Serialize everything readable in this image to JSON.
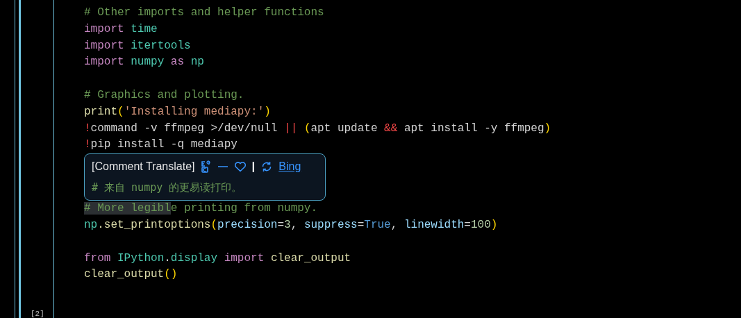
{
  "editor": {
    "lines": [
      {
        "kind": "code",
        "tokens": [
          {
            "text": "# Other imports and helper functions",
            "kind": "comment"
          }
        ]
      },
      {
        "kind": "code",
        "tokens": [
          {
            "text": "import ",
            "kind": "keyword"
          },
          {
            "text": "time",
            "kind": "module"
          }
        ]
      },
      {
        "kind": "code",
        "tokens": [
          {
            "text": "import ",
            "kind": "keyword"
          },
          {
            "text": "itertools",
            "kind": "module"
          }
        ]
      },
      {
        "kind": "code",
        "tokens": [
          {
            "text": "import ",
            "kind": "keyword"
          },
          {
            "text": "numpy ",
            "kind": "module"
          },
          {
            "text": "as ",
            "kind": "keyword"
          },
          {
            "text": "np",
            "kind": "module"
          }
        ]
      },
      {
        "kind": "blank"
      },
      {
        "kind": "code",
        "tokens": [
          {
            "text": "# Graphics and plotting.",
            "kind": "comment"
          }
        ]
      },
      {
        "kind": "code",
        "tokens": [
          {
            "text": "print",
            "kind": "function"
          },
          {
            "text": "(",
            "kind": "bracket"
          },
          {
            "text": "'Installing mediapy:'",
            "kind": "string"
          },
          {
            "text": ")",
            "kind": "bracket"
          }
        ]
      },
      {
        "kind": "code",
        "tokens": [
          {
            "text": "!",
            "kind": "operator"
          },
          {
            "text": "command -v ffmpeg >/dev/null ",
            "kind": "plain"
          },
          {
            "text": "|| ",
            "kind": "operator"
          },
          {
            "text": "(",
            "kind": "bracket"
          },
          {
            "text": "apt update ",
            "kind": "plain"
          },
          {
            "text": "&&",
            "kind": "operator"
          },
          {
            "text": " apt install -y ffmpeg",
            "kind": "plain"
          },
          {
            "text": ")",
            "kind": "bracket"
          }
        ]
      },
      {
        "kind": "code",
        "tokens": [
          {
            "text": "!",
            "kind": "operator"
          },
          {
            "text": "pip install -q mediapy",
            "kind": "plain"
          }
        ]
      }
    ],
    "popup": {
      "title": "[Comment Translate]",
      "separator": "|",
      "link": "Bing",
      "translation": "# 来自 numpy 的更易读打印。"
    },
    "lines_after": [
      {
        "kind": "code",
        "tokens": [
          {
            "text": "# More legibl",
            "kind": "comment",
            "highlighted": true
          },
          {
            "text": "e printing from numpy.",
            "kind": "comment",
            "highlighted": false
          }
        ]
      },
      {
        "kind": "code",
        "tokens": [
          {
            "text": "np",
            "kind": "module"
          },
          {
            "text": ".set_printoptions",
            "kind": "function"
          },
          {
            "text": "(",
            "kind": "bracket"
          },
          {
            "text": "precision",
            "kind": "param"
          },
          {
            "text": "=",
            "kind": "plain"
          },
          {
            "text": "3",
            "kind": "number"
          },
          {
            "text": ", ",
            "kind": "plain"
          },
          {
            "text": "suppress",
            "kind": "param"
          },
          {
            "text": "=",
            "kind": "plain"
          },
          {
            "text": "True",
            "kind": "constant"
          },
          {
            "text": ", ",
            "kind": "plain"
          },
          {
            "text": "linewidth",
            "kind": "param"
          },
          {
            "text": "=",
            "kind": "plain"
          },
          {
            "text": "100",
            "kind": "number"
          },
          {
            "text": ")",
            "kind": "bracket"
          }
        ]
      },
      {
        "kind": "blank"
      },
      {
        "kind": "code",
        "tokens": [
          {
            "text": "from ",
            "kind": "keyword"
          },
          {
            "text": "IPython",
            "kind": "module"
          },
          {
            "text": ".",
            "kind": "plain"
          },
          {
            "text": "display ",
            "kind": "module"
          },
          {
            "text": "import ",
            "kind": "keyword"
          },
          {
            "text": "clear_output",
            "kind": "function"
          }
        ]
      },
      {
        "kind": "code",
        "tokens": [
          {
            "text": "clear_output",
            "kind": "function"
          },
          {
            "text": "()",
            "kind": "bracket"
          }
        ]
      }
    ]
  },
  "next_cell": {
    "label": "[2]"
  }
}
